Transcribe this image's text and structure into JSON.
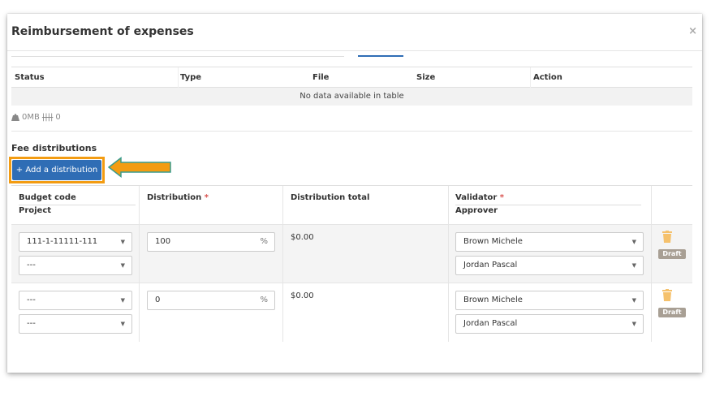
{
  "modal": {
    "title": "Reimbursement of expenses",
    "close": "×"
  },
  "files_table": {
    "headers": [
      "Status",
      "Type",
      "File",
      "Size",
      "Action"
    ],
    "empty_message": "No data available in table"
  },
  "file_stats": {
    "size": "0MB",
    "count": "0"
  },
  "fee_distributions": {
    "title": "Fee distributions",
    "add_button": "+ Add a distribution",
    "headers": {
      "budget_code": "Budget code",
      "project": "Project",
      "distribution": "Distribution",
      "distribution_total": "Distribution total",
      "validator": "Validator",
      "approver": "Approver",
      "required_mark": "*"
    },
    "rows": [
      {
        "budget_code": "111-1-11111-111",
        "project": "---",
        "distribution": "100",
        "unit": "%",
        "total": "$0.00",
        "validator": "Brown Michele",
        "approver": "Jordan Pascal",
        "status": "Draft"
      },
      {
        "budget_code": "---",
        "project": "---",
        "distribution": "0",
        "unit": "%",
        "total": "$0.00",
        "validator": "Brown Michele",
        "approver": "Jordan Pascal",
        "status": "Draft"
      }
    ]
  },
  "colors": {
    "primary": "#2f6db5",
    "highlight": "#f39c12",
    "arrow_border": "#3a9b8c",
    "trash": "#f5c16c",
    "draft_badge": "#a89f94",
    "required": "#d9534f"
  }
}
